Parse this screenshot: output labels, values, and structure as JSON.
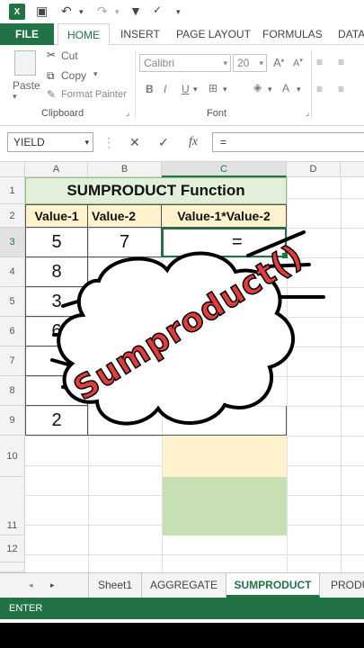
{
  "qat": {
    "app_icon": "X"
  },
  "ribbon_tabs": [
    "FILE",
    "HOME",
    "INSERT",
    "PAGE LAYOUT",
    "FORMULAS",
    "DATA"
  ],
  "clipboard": {
    "paste": "Paste",
    "cut": "Cut",
    "copy": "Copy",
    "format_painter": "Format Painter",
    "group": "Clipboard"
  },
  "font": {
    "name": "Calibri",
    "size": "20",
    "group": "Font",
    "bold": "B",
    "italic": "I",
    "underline": "U"
  },
  "formula_bar": {
    "name_box": "YIELD",
    "cancel": "✕",
    "enter": "✓",
    "fx": "fx",
    "formula": "="
  },
  "columns": [
    "A",
    "B",
    "C",
    "D"
  ],
  "rows": [
    "1",
    "2",
    "3",
    "4",
    "5",
    "6",
    "7",
    "8",
    "9",
    "10",
    "11",
    "12"
  ],
  "cells": {
    "title": "SUMPRODUCT Function",
    "h1": "Value-1",
    "h2": "Value-2",
    "h3": "Value-1*Value-2",
    "a3": "5",
    "b3": "7",
    "c3": "=",
    "a4": "8",
    "a5": "3",
    "a6": "6",
    "a9": "2"
  },
  "overlay_text": "Sumproduct()",
  "sheet_tabs": [
    "Sheet1",
    "AGGREGATE",
    "SUMPRODUCT",
    "PRODU"
  ],
  "status": "ENTER",
  "colors": {
    "excel_green": "#217346",
    "title_fill": "#e2efda",
    "header_fill": "#fff2cc",
    "green_fill": "#c6e0b4",
    "overlay_red": "#e03c3c"
  }
}
